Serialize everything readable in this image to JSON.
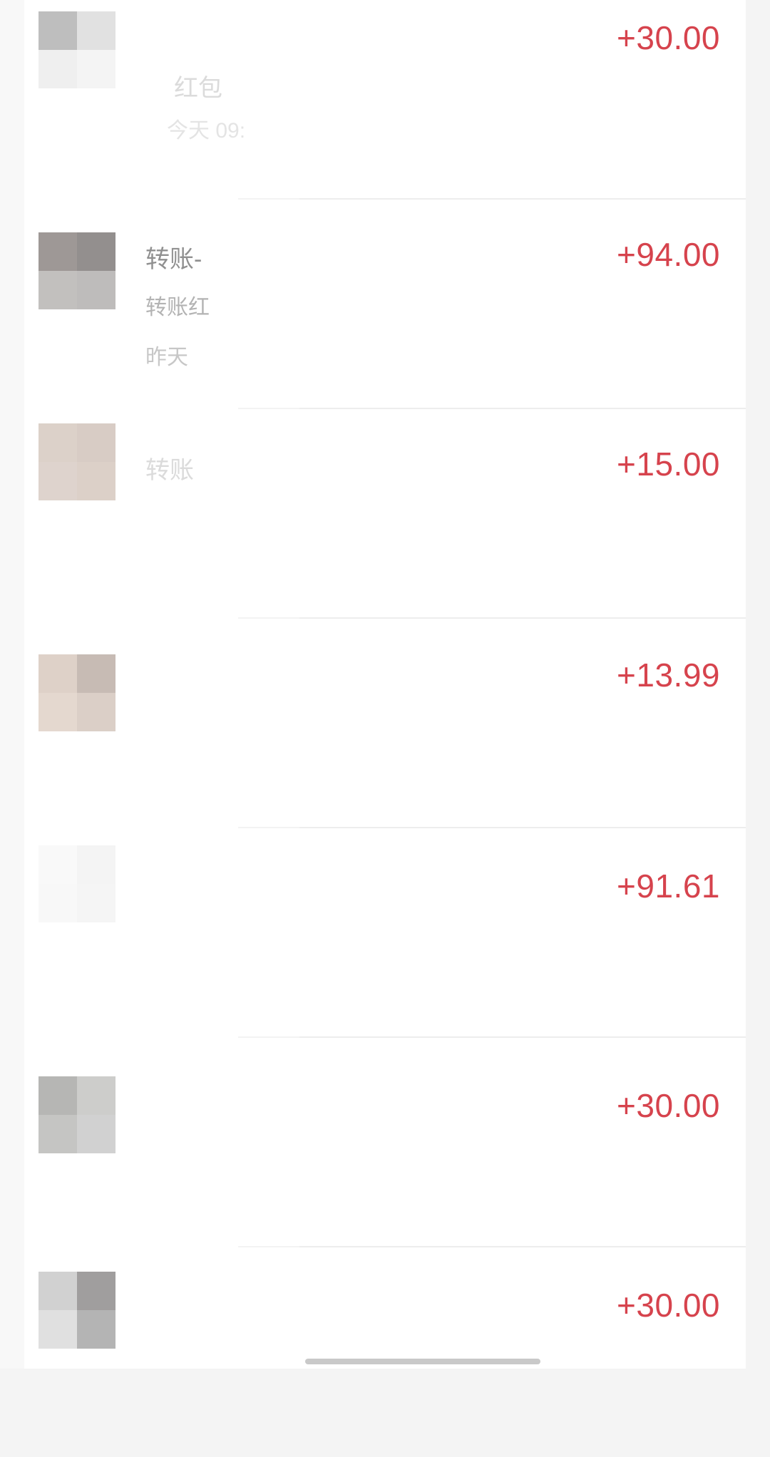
{
  "transactions": [
    {
      "title": "红包",
      "subtitle": "",
      "time": "今天 09:",
      "amount": "+30.00"
    },
    {
      "title": "转账-",
      "subtitle": "转账红",
      "time": "昨天",
      "amount": "+94.00"
    },
    {
      "title": "转账",
      "subtitle": "",
      "time": "",
      "amount": "+15.00"
    },
    {
      "title": "",
      "subtitle": "",
      "time": "",
      "amount": "+13.99"
    },
    {
      "title": "",
      "subtitle": "",
      "time": "",
      "amount": "+91.61"
    },
    {
      "title": "",
      "subtitle": "",
      "time": "",
      "amount": "+30.00"
    },
    {
      "title": "",
      "subtitle": "",
      "time": "",
      "amount": "+30.00"
    }
  ],
  "colors": {
    "amount": "#d6434d",
    "background": "#f4f4f4",
    "card": "#ffffff",
    "divider": "#ededed"
  }
}
